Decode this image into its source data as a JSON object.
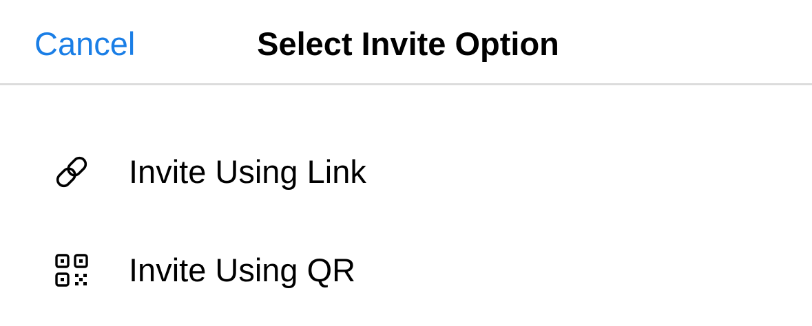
{
  "header": {
    "cancel_label": "Cancel",
    "title": "Select Invite Option"
  },
  "options": [
    {
      "label": "Invite Using Link",
      "icon": "link-icon"
    },
    {
      "label": "Invite Using QR",
      "icon": "qr-code-icon"
    }
  ],
  "colors": {
    "accent": "#1a7ee6",
    "divider": "#dcdcdc",
    "text": "#000000"
  }
}
